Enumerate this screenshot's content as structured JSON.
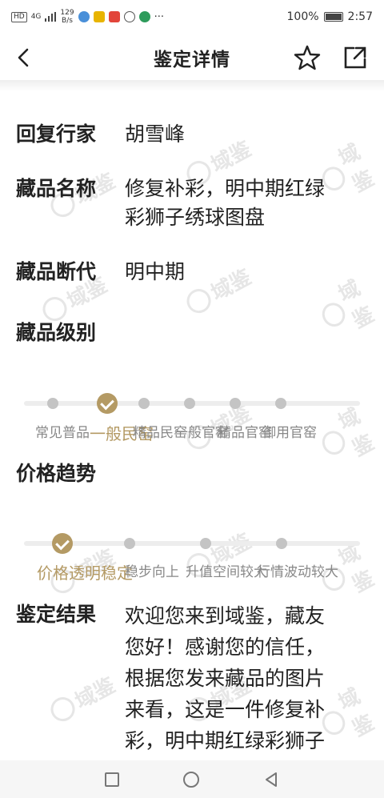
{
  "status_bar": {
    "network_tag": "HD",
    "signal_label": "4G",
    "speed_value": "129",
    "speed_unit": "B/s",
    "more": "···",
    "battery": "100%",
    "time": "2:57"
  },
  "header": {
    "title": "鉴定详情",
    "icons": {
      "back": "chevron-left-icon",
      "favorite": "star-icon",
      "share": "share-icon"
    }
  },
  "details": [
    {
      "label": "回复行家",
      "value": "胡雪峰"
    },
    {
      "label": "藏品名称",
      "value": "修复补彩，明中期红绿彩狮子绣球图盘"
    },
    {
      "label": "藏品断代",
      "value": "明中期"
    },
    {
      "label": "藏品级别",
      "value": ""
    }
  ],
  "level_scale": {
    "options": [
      "常见普品",
      "一般民窑",
      "精品民窑",
      "一般官窑",
      "精品官窑",
      "御用官窑"
    ],
    "selected_index": 1
  },
  "price_trend": {
    "label": "价格趋势",
    "options": [
      "价格透明稳定",
      "稳步向上",
      "升值空间较大",
      "行情波动较大"
    ],
    "selected_index": 0
  },
  "result": {
    "label": "鉴定结果",
    "text": "欢迎您来到域鉴，藏友您好！感谢您的信任，根据您发来藏品的图片来看，这是一件修复补彩，明中期红绿彩狮子绣球图"
  },
  "watermark": {
    "text": "域鉴"
  },
  "colors": {
    "accent": "#b49a64",
    "inactive_dot": "#c4c4c4",
    "track": "#ededed"
  }
}
